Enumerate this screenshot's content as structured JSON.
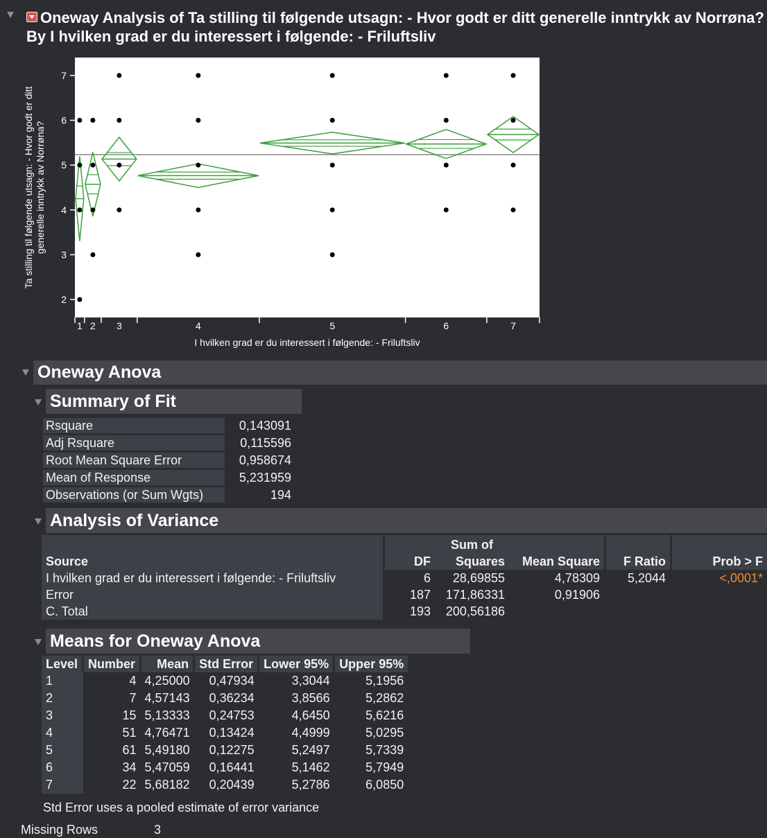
{
  "title": "Oneway Analysis of Ta stilling til følgende utsagn: - Hvor godt er ditt generelle inntrykk av Norrøna? By I hvilken grad er du interessert i følgende: - Friluftsliv",
  "colors": {
    "background": "#2b2d31",
    "header": "#45474d",
    "diamond": "#3aa03a",
    "prob": "#f08c2a"
  },
  "chart_data": {
    "type": "scatter",
    "subtype": "oneway-means-diamonds",
    "xlabel": "I hvilken grad er du interessert i følgende: - Friluftsliv",
    "ylabel_lines": [
      "Ta stilling til følgende utsagn: - Hvor godt er ditt",
      "generelle inntrykk av Norrøna?"
    ],
    "yticks": [
      "2",
      "3",
      "4",
      "5",
      "6",
      "7"
    ],
    "ylim": [
      1.6,
      7.4
    ],
    "grand_mean": 5.231959,
    "levels": [
      {
        "label": "1",
        "n": 4,
        "mean": 4.25,
        "lower": 3.3044,
        "upper": 5.1956,
        "points": [
          2,
          4,
          5,
          6
        ]
      },
      {
        "label": "2",
        "n": 7,
        "mean": 4.57143,
        "lower": 3.8566,
        "upper": 5.2862,
        "points": [
          3,
          4,
          5,
          6
        ]
      },
      {
        "label": "3",
        "n": 15,
        "mean": 5.13333,
        "lower": 4.645,
        "upper": 5.6216,
        "points": [
          4,
          5,
          6,
          7
        ]
      },
      {
        "label": "4",
        "n": 51,
        "mean": 4.76471,
        "lower": 4.4999,
        "upper": 5.0295,
        "points": [
          3,
          4,
          5,
          6,
          7
        ]
      },
      {
        "label": "5",
        "n": 61,
        "mean": 5.4918,
        "lower": 5.2497,
        "upper": 5.7339,
        "points": [
          3,
          4,
          5,
          6,
          7
        ]
      },
      {
        "label": "6",
        "n": 34,
        "mean": 5.47059,
        "lower": 5.1462,
        "upper": 5.7949,
        "points": [
          4,
          5,
          6,
          7
        ]
      },
      {
        "label": "7",
        "n": 22,
        "mean": 5.68182,
        "lower": 5.2786,
        "upper": 6.085,
        "points": [
          4,
          5,
          6,
          7
        ]
      }
    ]
  },
  "oneway_anova": {
    "title": "Oneway Anova",
    "summary_title": "Summary of Fit",
    "summary": [
      {
        "label": "Rsquare",
        "value": "0,143091"
      },
      {
        "label": "Adj Rsquare",
        "value": "0,115596"
      },
      {
        "label": "Root Mean Square Error",
        "value": "0,958674"
      },
      {
        "label": "Mean of Response",
        "value": "5,231959"
      },
      {
        "label": "Observations (or Sum Wgts)",
        "value": "194"
      }
    ],
    "aov_title": "Analysis of Variance",
    "aov_headers": {
      "source": "Source",
      "df": "DF",
      "ss_top": "Sum of",
      "ss_bottom": "Squares",
      "ms": "Mean Square",
      "f": "F Ratio",
      "p": "Prob > F"
    },
    "aov_rows": [
      {
        "source": "I hvilken grad er du interessert i følgende: - Friluftsliv",
        "df": "6",
        "ss": "28,69855",
        "ms": "4,78309",
        "f": "5,2044",
        "p": "<,0001*"
      },
      {
        "source": "Error",
        "df": "187",
        "ss": "171,86331",
        "ms": "0,91906",
        "f": "",
        "p": ""
      },
      {
        "source": "C. Total",
        "df": "193",
        "ss": "200,56186",
        "ms": "",
        "f": "",
        "p": ""
      }
    ],
    "means_title": "Means for Oneway Anova",
    "means_headers": [
      "Level",
      "Number",
      "Mean",
      "Std Error",
      "Lower 95%",
      "Upper 95%"
    ],
    "means_rows": [
      [
        "1",
        "4",
        "4,25000",
        "0,47934",
        "3,3044",
        "5,1956"
      ],
      [
        "2",
        "7",
        "4,57143",
        "0,36234",
        "3,8566",
        "5,2862"
      ],
      [
        "3",
        "15",
        "5,13333",
        "0,24753",
        "4,6450",
        "5,6216"
      ],
      [
        "4",
        "51",
        "4,76471",
        "0,13424",
        "4,4999",
        "5,0295"
      ],
      [
        "5",
        "61",
        "5,49180",
        "0,12275",
        "5,2497",
        "5,7339"
      ],
      [
        "6",
        "34",
        "5,47059",
        "0,16441",
        "5,1462",
        "5,7949"
      ],
      [
        "7",
        "22",
        "5,68182",
        "0,20439",
        "5,2786",
        "6,0850"
      ]
    ],
    "means_note": "Std Error uses a pooled estimate of error variance"
  },
  "missing": {
    "label": "Missing Rows",
    "value": "3"
  }
}
